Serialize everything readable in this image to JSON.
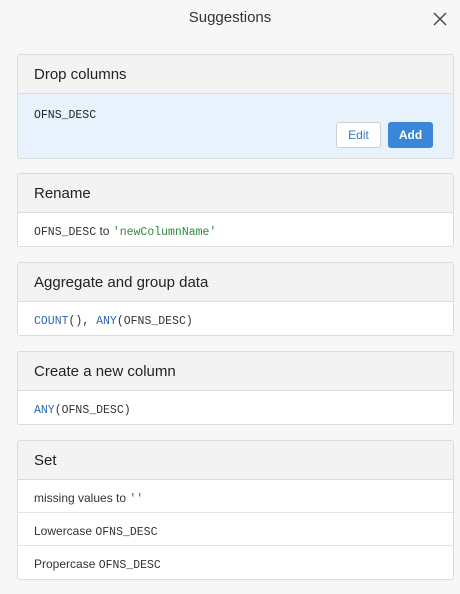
{
  "header": {
    "title": "Suggestions"
  },
  "drop_columns": {
    "title": "Drop columns",
    "column": "OFNS_DESC",
    "edit_label": "Edit",
    "add_label": "Add"
  },
  "rename": {
    "title": "Rename",
    "column": "OFNS_DESC",
    "connector": " to ",
    "new_name": "'newColumnName'"
  },
  "aggregate": {
    "title": "Aggregate and group data",
    "fn1": "COUNT",
    "fn1_args": "(), ",
    "fn2": "ANY",
    "fn2_args": "(OFNS_DESC)"
  },
  "create_column": {
    "title": "Create a new column",
    "fn": "ANY",
    "args": "(OFNS_DESC)"
  },
  "set": {
    "title": "Set",
    "items": [
      {
        "text": "missing values to ",
        "code": "''"
      },
      {
        "text": "Lowercase ",
        "code": "OFNS_DESC"
      },
      {
        "text": "Propercase ",
        "code": "OFNS_DESC"
      }
    ]
  },
  "colors": {
    "accent": "#3a86d8",
    "function": "#2f67b5",
    "string": "#2e8b3a",
    "selected_bg": "#e8f2fc"
  }
}
